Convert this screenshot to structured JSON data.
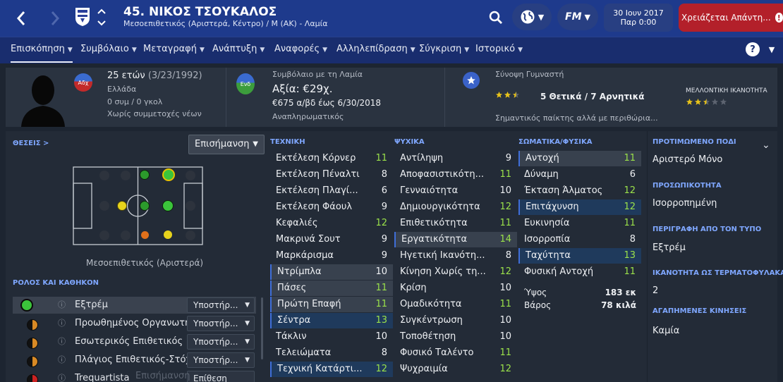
{
  "header": {
    "title": "45. ΝΙΚΟΣ ΤΣΟΥΚΑΛΟΣ",
    "subtitle": "Μεσοεπιθετικός (Αριστερά, Κέντρο) / Μ (ΑΚ) - Λαμία",
    "date": "30 Ιουν 2017",
    "time": "Παρ 0:00",
    "alert": "Χρειάζεται Απάντη...",
    "fm_label": "FM"
  },
  "nav": [
    "Επισκόπηση",
    "Συμβόλαιο",
    "Μεταγραφή",
    "Ανάπτυξη",
    "Αναφορές",
    "Αλληλεπίδραση",
    "Σύγκριση",
    "Ιστορικό"
  ],
  "profile": {
    "age": "25 ετών",
    "dob": "(3/23/1992)",
    "nation": "Ελλάδα",
    "caps": "0 συμ / 0 γκολ",
    "youth": "Χωρίς συμμετοχές νέων",
    "badge": "Αδχ"
  },
  "contract": {
    "label": "Συμβόλαιο με τη Λαμία",
    "value": "Αξία: €29χ.",
    "wage": "€675 α/βδ έως 6/30/2018",
    "status": "Αναπληρωματικός",
    "badge": "Ενδ"
  },
  "coach": {
    "label": "Σύνοψη Γυμναστή",
    "summary": "5 Θετικά / 7 Αρνητικά",
    "note": "Σημαντικός παίκτης αλλά με περιθώρια...",
    "potential_label": "ΜΕΛΛΟΝΤΙΚΗ ΙΚΑΝΟΤΗΤΑ",
    "current_stars": 2.5,
    "potential_stars": 2.5,
    "max_stars": 5
  },
  "positions": {
    "title": "ΘΕΣΕΙΣ",
    "dropdown": "Επισήμανση",
    "caption": "Μεσοεπιθετικός (Αριστερά)"
  },
  "roles": {
    "title": "ΡΟΛΟΣ ΚΑΙ ΚΑΘΗΚΟΝ",
    "items": [
      {
        "name": "Εξτρέμ",
        "duty": "Υποστήρ..."
      },
      {
        "name": "Προωθημένος Οργανωτής",
        "duty": "Υποστήρ..."
      },
      {
        "name": "Εσωτερικός Επιθετικός",
        "duty": "Υποστήρ..."
      },
      {
        "name": "Πλάγιος Επιθετικός-Στόχος",
        "duty": "Υποστήρ..."
      },
      {
        "name": "Trequartista",
        "duty": "Επίθεση"
      }
    ]
  },
  "technical": {
    "title": "ΤΕΧΝΙΚΗ",
    "rows": [
      [
        "Εκτέλεση Κόρνερ",
        "11"
      ],
      [
        "Εκτέλεση Πέναλτι",
        "8"
      ],
      [
        "Εκτέλεση Πλαγί...",
        "6"
      ],
      [
        "Εκτέλεση Φάουλ",
        "9"
      ],
      [
        "Κεφαλιές",
        "12"
      ],
      [
        "Μακρινά Σουτ",
        "9"
      ],
      [
        "Μαρκάρισμα",
        "9"
      ],
      [
        "Ντρίμπλα",
        "10"
      ],
      [
        "Πάσες",
        "11"
      ],
      [
        "Πρώτη Επαφή",
        "11"
      ],
      [
        "Σέντρα",
        "13"
      ],
      [
        "Τάκλιν",
        "10"
      ],
      [
        "Τελειώματα",
        "8"
      ],
      [
        "Τεχνική Κατάρτι...",
        "12"
      ]
    ]
  },
  "mental": {
    "title": "ΨΥΧΙΚΑ",
    "rows": [
      [
        "Αντίληψη",
        "9"
      ],
      [
        "Αποφασιστικότη...",
        "11"
      ],
      [
        "Γενναιότητα",
        "10"
      ],
      [
        "Δημιουργικότητα",
        "12"
      ],
      [
        "Επιθετικότητα",
        "11"
      ],
      [
        "Εργατικότητα",
        "14"
      ],
      [
        "Ηγετική Ικανότη...",
        "8"
      ],
      [
        "Κίνηση Χωρίς τη...",
        "12"
      ],
      [
        "Κρίση",
        "10"
      ],
      [
        "Ομαδικότητα",
        "11"
      ],
      [
        "Συγκέντρωση",
        "10"
      ],
      [
        "Τοποθέτηση",
        "10"
      ],
      [
        "Φυσικό Ταλέντο",
        "11"
      ],
      [
        "Ψυχραιμία",
        "12"
      ]
    ]
  },
  "physical": {
    "title": "ΣΩΜΑΤΙΚΑ/ΦΥΣΙΚΑ",
    "rows": [
      [
        "Αντοχή",
        "11"
      ],
      [
        "Δύναμη",
        "6"
      ],
      [
        "Έκταση Άλματος",
        "12"
      ],
      [
        "Επιτάχυνση",
        "12"
      ],
      [
        "Ευκινησία",
        "11"
      ],
      [
        "Ισορροπία",
        "8"
      ],
      [
        "Ταχύτητα",
        "13"
      ],
      [
        "Φυσική Αντοχή",
        "11"
      ]
    ],
    "height_label": "Ύψος",
    "height": "183 εκ",
    "weight_label": "Βάρος",
    "weight": "78 κιλά"
  },
  "info": [
    {
      "label": "ΠΡΟΤΙΜΩΜΕΝΟ ΠΟΔΙ",
      "value": "Αριστερό Μόνο"
    },
    {
      "label": "ΠΡΟΣΩΠΙΚΟΤΗΤΑ",
      "value": "Ισορροπημένη"
    },
    {
      "label": "ΠΕΡΙΓΡΑΦΗ ΑΠΟ ΤΟΝ ΤΥΠΟ",
      "value": "Εξτρέμ"
    },
    {
      "label": "ΙΚΑΝΟΤΗΤΑ ΩΣ ΤΕΡΜΑΤΟΦΥΛΑΚΑΣ",
      "value": "2"
    },
    {
      "label": "ΑΓΑΠΗΜΕΝΕΣ ΚΙΝΗΣΕΙΣ",
      "value": "Καμία"
    }
  ],
  "footer_overlay": "Επισήμανση",
  "colors": {
    "accent": "#3f6ed8",
    "good": "#9be24a",
    "topbar": "#1e3a8c",
    "alert": "#b3202a"
  }
}
